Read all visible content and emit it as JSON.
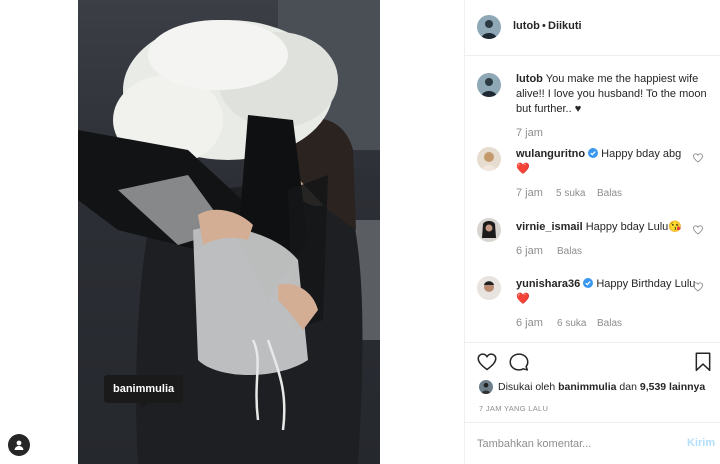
{
  "photo": {
    "tag_label": "banimmulia",
    "icons": {
      "user_tag": "user-tag-icon"
    }
  },
  "header": {
    "username": "lutob",
    "separator": "•",
    "follow_status": "Diikuti"
  },
  "caption": {
    "username": "lutob",
    "text": "You make me the happiest wife alive!! I love you husband! To the moon but further.. ♥",
    "time": "7 jam"
  },
  "comments": [
    {
      "username": "wulanguritno",
      "verified": true,
      "text": "Happy bday abg",
      "emoji": "❤️",
      "time": "7 jam",
      "likes": "5 suka",
      "reply": "Balas"
    },
    {
      "username": "virnie_ismail",
      "verified": false,
      "text": "Happy bday Lulu",
      "emoji": "😘",
      "time": "6 jam",
      "likes": "",
      "reply": "Balas"
    },
    {
      "username": "yunishara36",
      "verified": true,
      "text": "Happy Birthday Lulu",
      "emoji": "❤️",
      "time": "6 jam",
      "likes": "6 suka",
      "reply": "Balas"
    }
  ],
  "actions": {
    "icons": [
      "heart-outline-icon",
      "comment-bubble-icon",
      "bookmark-icon"
    ]
  },
  "likes": {
    "prefix": "Disukai oleh",
    "user": "banimmulia",
    "connector": "dan",
    "count": "9,539 lainnya"
  },
  "timestamp": "7 JAM YANG LALU",
  "comment_box": {
    "placeholder": "Tambahkan komentar...",
    "post_label": "Kirim"
  },
  "colors": {
    "verified_blue": "#3897f0",
    "heart_red": "#ed4956",
    "meta_gray": "#8e8e8e",
    "post_disabled": "#b2dffc"
  }
}
